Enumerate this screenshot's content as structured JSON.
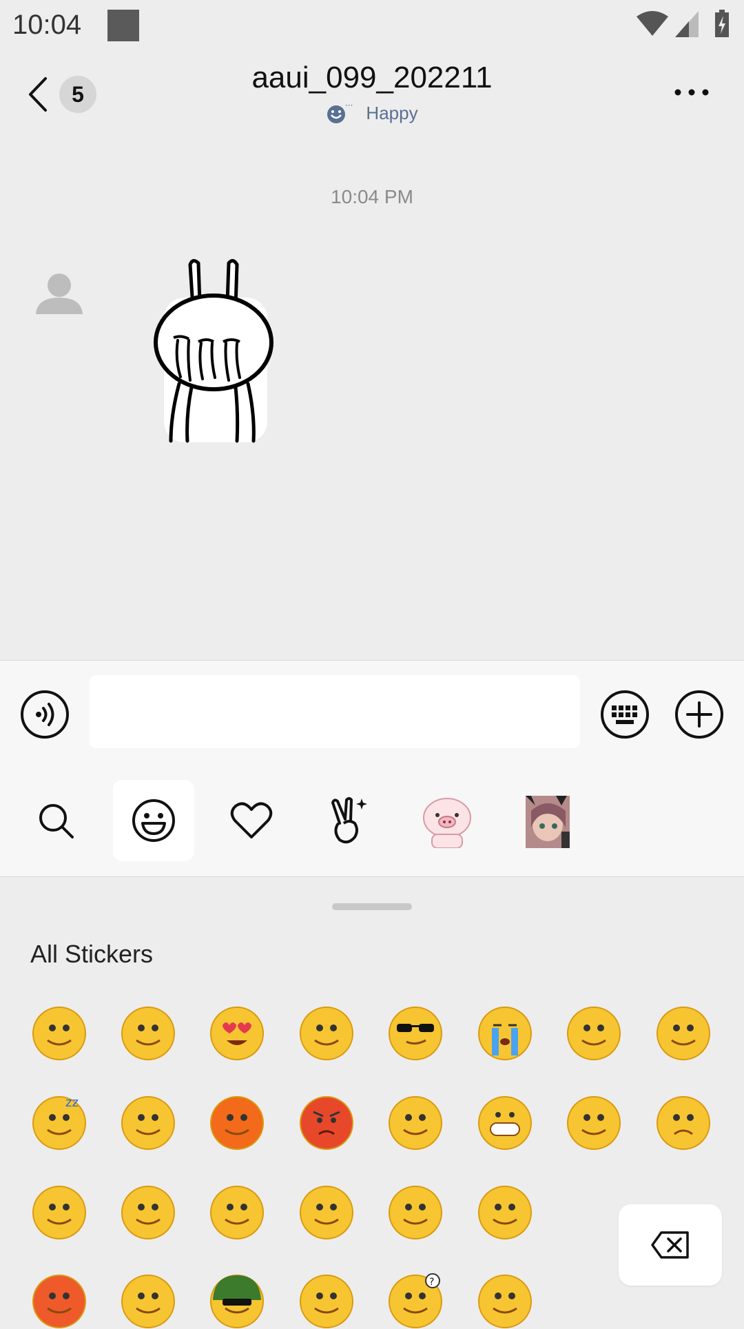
{
  "status_bar": {
    "time": "10:04"
  },
  "header": {
    "unread_count": "5",
    "title": "aaui_099_202211",
    "status": "Happy"
  },
  "chat": {
    "timestamp": "10:04 PM",
    "messages": [
      {
        "type": "sticker",
        "sender": "contact"
      }
    ]
  },
  "input": {
    "value": "",
    "placeholder": ""
  },
  "sticker_tabs": [
    {
      "icon": "search-icon",
      "selected": false
    },
    {
      "icon": "smiley-icon",
      "selected": true
    },
    {
      "icon": "heart-icon",
      "selected": false
    },
    {
      "icon": "victory-hand-icon",
      "selected": false
    },
    {
      "icon": "pig-sticker-pack",
      "selected": false
    },
    {
      "icon": "anime-girl-sticker-pack",
      "selected": false
    }
  ],
  "panel": {
    "section_title": "All Stickers"
  },
  "emojis": [
    "smile",
    "blush-worried",
    "heart-eyes",
    "side-eye",
    "cool-sunglasses",
    "crying",
    "embarrassed",
    "speechless-wrapped",
    "sleepy",
    "frustrated",
    "sweating-hot",
    "angry",
    "tongue-wink",
    "grin",
    "surprised",
    "sad",
    "flushed",
    "laughing-tears",
    "nauseous",
    "facepalm",
    "blush-smile",
    "astonished",
    "scared-sweat",
    "cheerful",
    "army-helmet",
    "cry-laugh",
    "thinking",
    "shush"
  ],
  "colors": {
    "accent_status": "#5a6f93",
    "emoji_yellow": "#f7c531",
    "background": "#ededed"
  }
}
